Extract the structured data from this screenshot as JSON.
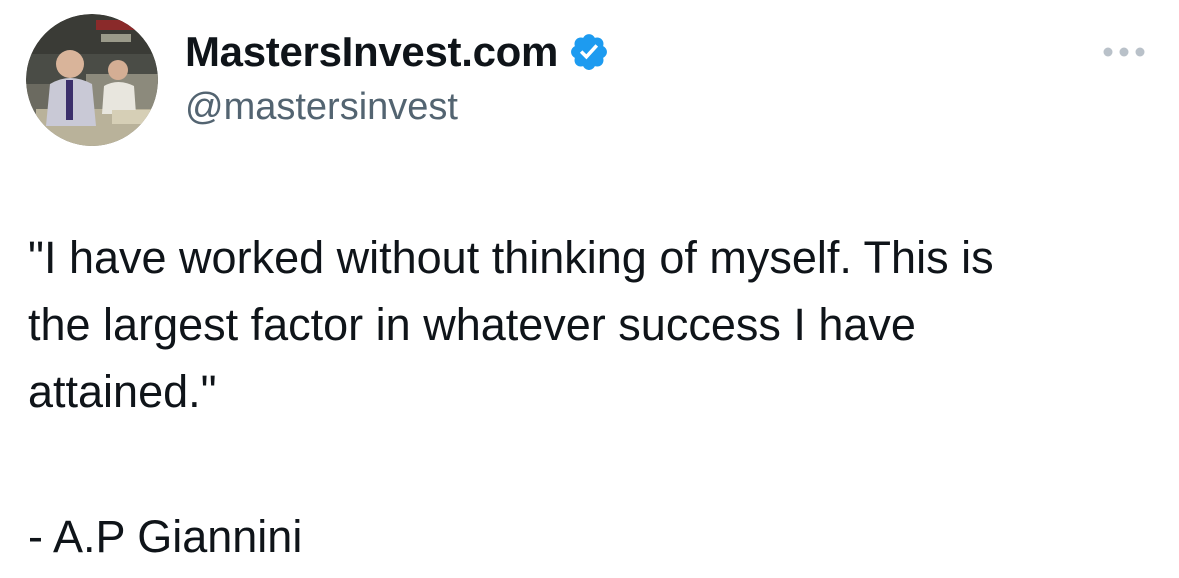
{
  "author": {
    "display_name": "MastersInvest.com",
    "handle": "@mastersinvest",
    "verified": true,
    "verified_color": "#1d9bf0",
    "avatar_icon": "trader-photo-avatar"
  },
  "tweet": {
    "quote_line_1": "\"I have worked without thinking of myself. This is",
    "quote_line_2": "the largest factor in whatever success I have",
    "quote_line_3": "attained.\"",
    "attribution": "- A.P Giannini"
  },
  "actions": {
    "more_icon": "more-options-icon"
  },
  "colors": {
    "text": "#0f1419",
    "secondary": "#536471",
    "more_dots": "#b9c1c9"
  }
}
